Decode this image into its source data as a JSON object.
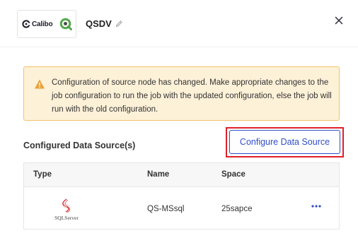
{
  "header": {
    "brand_logo_text": "Calibo",
    "title": "QSDV"
  },
  "warning": {
    "message": "Configuration of source node has changed. Make appropriate changes to the job configuration to run the job with the updated configuration, else the job will run with the old configuration."
  },
  "section": {
    "label": "Configured Data Source(s)",
    "configure_button": "Configure Data Source"
  },
  "table": {
    "columns": [
      "Type",
      "Name",
      "Space"
    ],
    "rows": [
      {
        "type_logo_text": "SQLServer",
        "name": "QS-MSsql",
        "space": "25sapce"
      }
    ]
  },
  "colors": {
    "accent": "#2f4ec8",
    "highlight": "#e0202a",
    "warning_bg": "#fdf1d8",
    "warning_border": "#f2c26b"
  }
}
